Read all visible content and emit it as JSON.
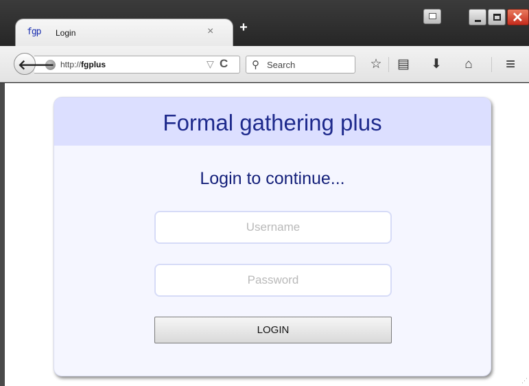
{
  "tab": {
    "favicon": "fgp",
    "title": "Login",
    "close": "×",
    "new_tab": "+"
  },
  "toolbar": {
    "back": "🡐",
    "url_prefix": "http://",
    "url_host": "fgplus",
    "url_dropdown": "▽",
    "reload": "C",
    "search_placeholder": "Search",
    "bookmark": "☆",
    "reading_list": "▤",
    "downloads": "⬇",
    "home": "⌂",
    "menu": "≡"
  },
  "window": {
    "close": "✕"
  },
  "page": {
    "brand": "Formal gathering plus",
    "subtitle": "Login to continue...",
    "username_placeholder": "Username",
    "password_placeholder": "Password",
    "login_label": "LOGIN"
  },
  "colors": {
    "header_bg": "#dcdfff",
    "card_bg": "#f5f6ff",
    "brand_text": "#1e2a8c"
  }
}
